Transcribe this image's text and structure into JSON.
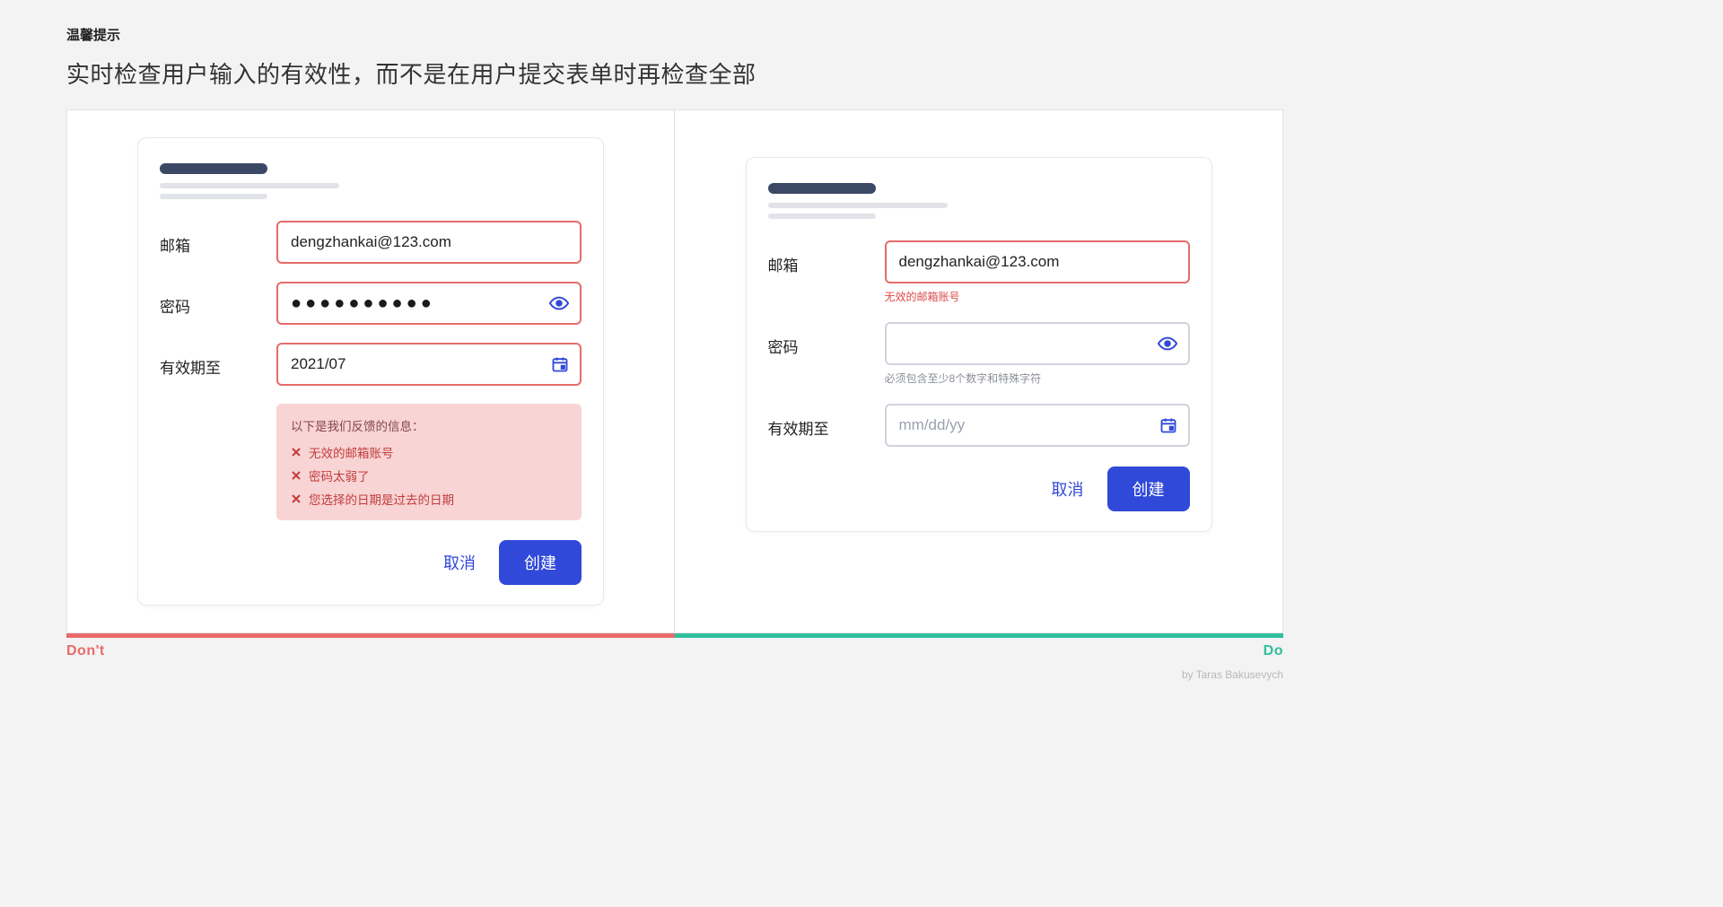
{
  "header": {
    "tip_label": "温馨提示",
    "heading": "实时检查用户输入的有效性，而不是在用户提交表单时再检查全部"
  },
  "dont_panel": {
    "fields": {
      "email": {
        "label": "邮箱",
        "value": "dengzhankai@123.com"
      },
      "password": {
        "label": "密码",
        "masked": "●●●●●●●●●●"
      },
      "expiry": {
        "label": "有效期至",
        "value": "2021/07"
      }
    },
    "error_summary": {
      "title": "以下是我们反馈的信息：",
      "items": [
        "无效的邮箱账号",
        "密码太弱了",
        "您选择的日期是过去的日期"
      ]
    },
    "actions": {
      "cancel": "取消",
      "create": "创建"
    }
  },
  "do_panel": {
    "fields": {
      "email": {
        "label": "邮箱",
        "value": "dengzhankai@123.com",
        "error": "无效的邮箱账号"
      },
      "password": {
        "label": "密码",
        "value": "",
        "helper": "必须包含至少8个数字和特殊字符"
      },
      "expiry": {
        "label": "有效期至",
        "placeholder": "mm/dd/yy"
      }
    },
    "actions": {
      "cancel": "取消",
      "create": "创建"
    }
  },
  "legend": {
    "dont": "Don't",
    "do": "Do"
  },
  "byline": "by Taras Bakusevych",
  "colors": {
    "error_border": "#e76b6b",
    "neutral_border": "#cfd3dc",
    "primary": "#3149d8",
    "dont": "#ea6a6a",
    "do": "#2fbf9d"
  }
}
